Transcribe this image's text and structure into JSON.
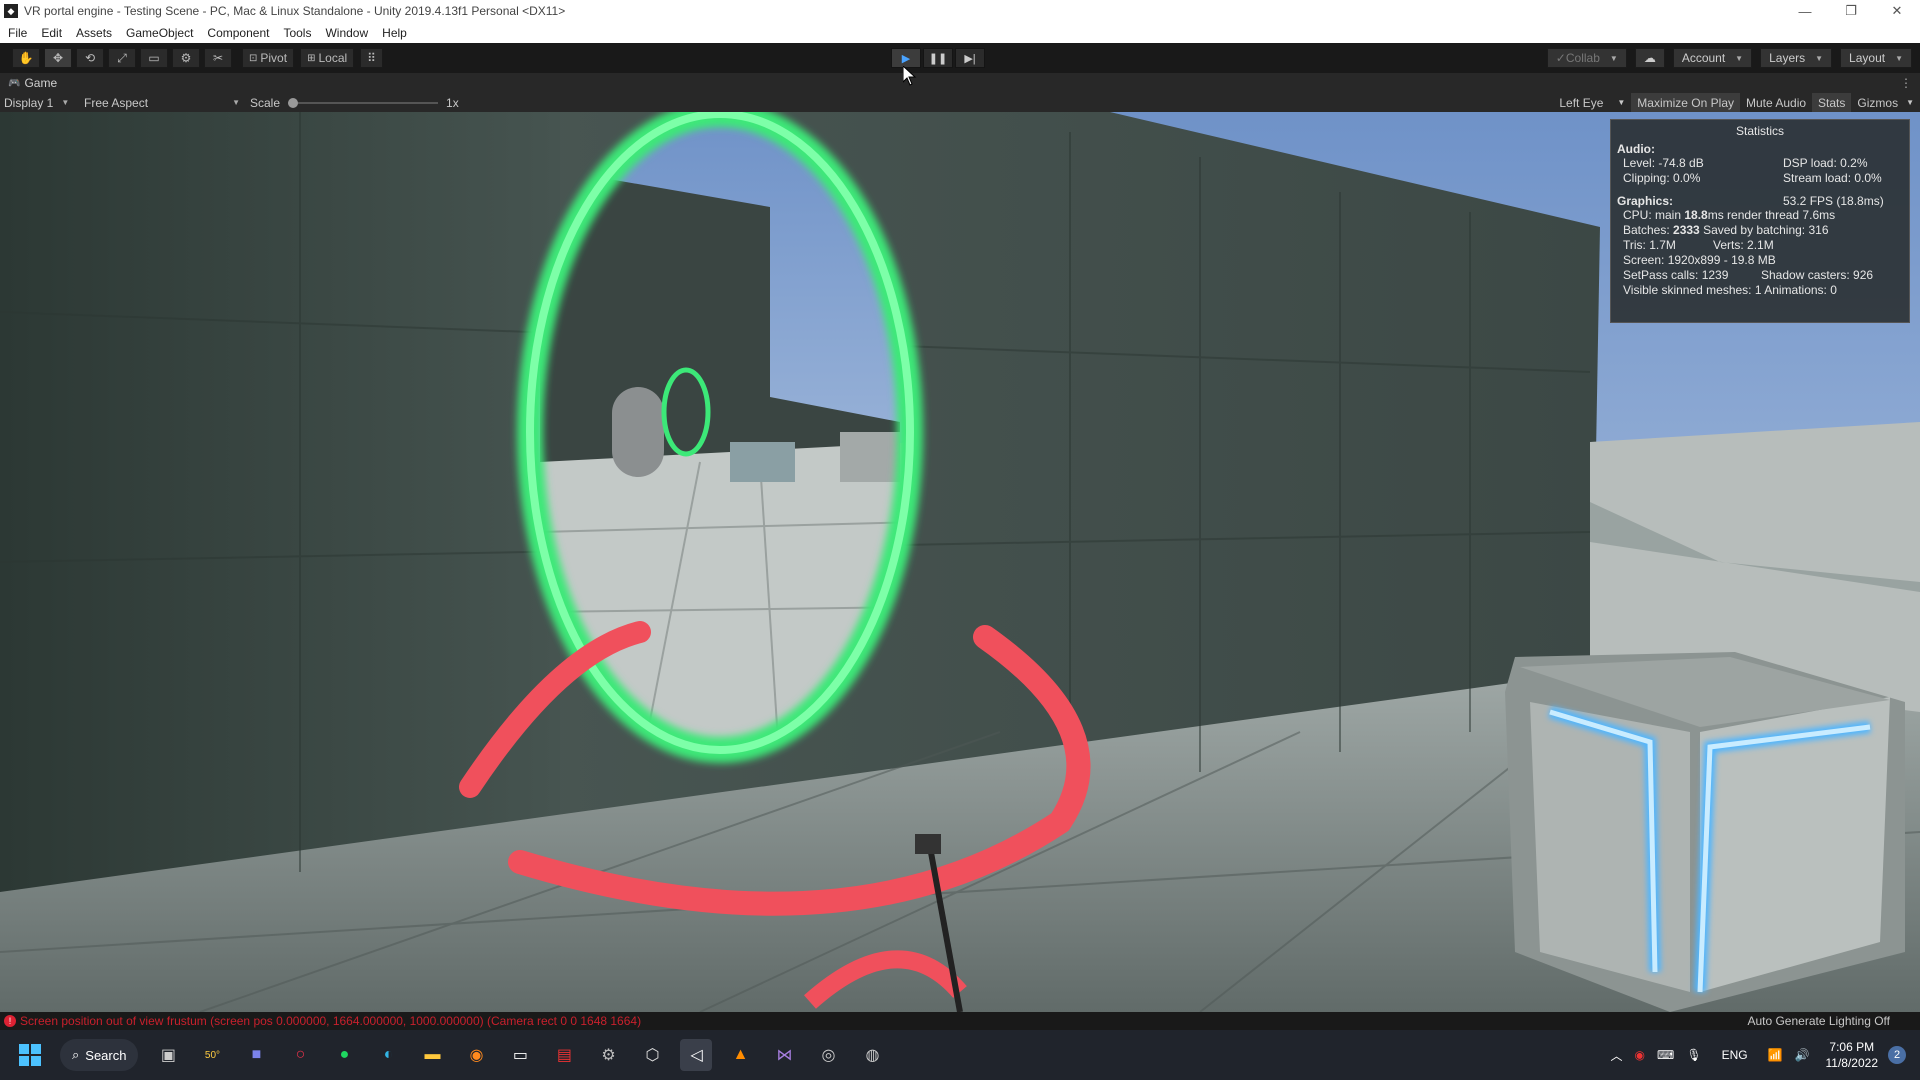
{
  "window": {
    "title": "VR portal engine - Testing Scene - PC, Mac & Linux Standalone - Unity 2019.4.13f1 Personal <DX11>",
    "controls": [
      "—",
      "❐",
      "✕"
    ]
  },
  "menu": [
    "File",
    "Edit",
    "Assets",
    "GameObject",
    "Component",
    "Tools",
    "Window",
    "Help"
  ],
  "toolbar": {
    "tools": [
      "✋",
      "✥",
      "⟲",
      "⤢",
      "▭",
      "⚙",
      "✂"
    ],
    "pivot_label": "Pivot",
    "local_label": "Local",
    "grid_glyph": "⠿",
    "play_glyph": "▶",
    "pause_glyph": "❚❚",
    "step_glyph": "▶|",
    "collab_label": "Collab",
    "cloud_glyph": "☁",
    "account_label": "Account",
    "layers_label": "Layers",
    "layout_label": "Layout"
  },
  "game_tab": {
    "label": "Game",
    "more": "⋮"
  },
  "game_bar": {
    "display": "Display 1",
    "aspect": "Free Aspect",
    "scale_label": "Scale",
    "scale_value": "1x",
    "eye": "Left Eye",
    "maximize": "Maximize On Play",
    "mute": "Mute Audio",
    "stats": "Stats",
    "gizmos": "Gizmos"
  },
  "stats": {
    "title": "Statistics",
    "audio_header": "Audio:",
    "level": "Level: -74.8 dB",
    "dsp": "DSP load: 0.2%",
    "clipping": "Clipping: 0.0%",
    "stream": "Stream load: 0.0%",
    "graphics_header": "Graphics:",
    "fps": "53.2 FPS (18.8ms)",
    "cpu_prefix": "CPU: main ",
    "cpu_main": "18.8",
    "cpu_suffix": "ms  render thread 7.6ms",
    "batches_prefix": "Batches: ",
    "batches": "2333",
    "batches_suffix": "  Saved by batching: 316",
    "tris": "Tris: 1.7M",
    "verts": "Verts: 2.1M",
    "screen": "Screen: 1920x899 - 19.8 MB",
    "setpass": "SetPass calls: 1239",
    "shadow": "Shadow casters: 926",
    "skinned": "Visible skinned meshes: 1  Animations: 0"
  },
  "status": {
    "error": "Screen position out of view frustum (screen pos 0.000000, 1664.000000, 1000.000000) (Camera rect 0 0 1648 1664)",
    "lighting": "Auto Generate Lighting Off"
  },
  "taskbar": {
    "search_label": "Search",
    "weather": "50°",
    "lang": "ENG",
    "time": "7:06 PM",
    "date": "11/8/2022",
    "notif_count": "2"
  },
  "colors": {
    "portal_green": "#3ce878",
    "portal_red": "#f0505c",
    "box_glow": "#4fb6ff"
  }
}
